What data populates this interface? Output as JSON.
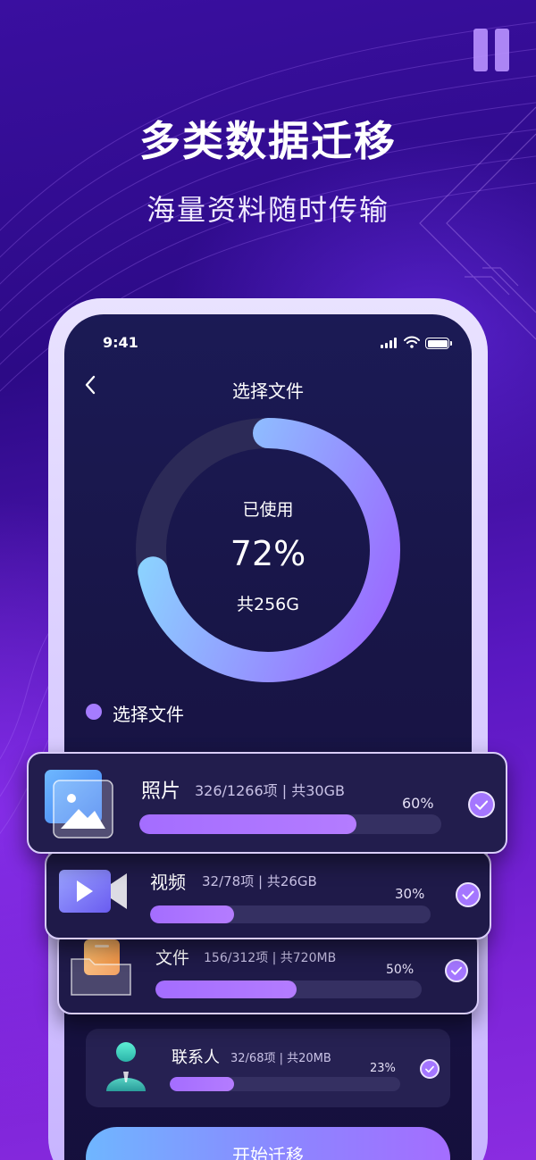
{
  "hero": {
    "title": "多类数据迁移",
    "subtitle": "海量资料随时传输"
  },
  "status_bar": {
    "time": "9:41"
  },
  "nav": {
    "title": "选择文件"
  },
  "storage": {
    "used_label": "已使用",
    "used_percent": "72%",
    "used_fraction": 0.72,
    "total": "共256G"
  },
  "legend": {
    "label": "选择文件"
  },
  "categories": [
    {
      "name": "照片",
      "detail": "326/1266项 | 共30GB",
      "percent": "60%",
      "progress": 0.72,
      "icon": "photo-icon",
      "checked": true
    },
    {
      "name": "视频",
      "detail": "32/78项 | 共26GB",
      "percent": "30%",
      "progress": 0.3,
      "icon": "video-icon",
      "checked": true
    },
    {
      "name": "文件",
      "detail": "156/312项 | 共720MB",
      "percent": "50%",
      "progress": 0.53,
      "icon": "folder-icon",
      "checked": true
    },
    {
      "name": "联系人",
      "detail": "32/68项 | 共20MB",
      "percent": "23%",
      "progress": 0.28,
      "icon": "contact-icon",
      "checked": true
    }
  ],
  "actions": {
    "start": "开始迁移"
  },
  "colors": {
    "accent": "#a46dff",
    "ring_start": "#8bd4ff",
    "ring_end": "#9a6bff",
    "background": "#3a0fa0"
  }
}
